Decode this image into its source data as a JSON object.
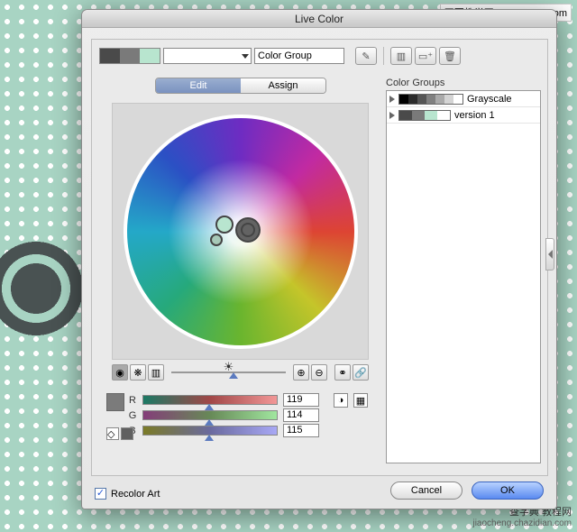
{
  "watermarks": {
    "top_right": "网页教学网\nwww.webjx.com",
    "bottom_right_title": "查字典 教程网",
    "bottom_right_sub": "jiaocheng.chazidian.com"
  },
  "dialog": {
    "title": "Live Color",
    "swatches": [
      "#4a4a4a",
      "#7a7a7a",
      "#b8e5cf"
    ],
    "color_group_field": "Color Group",
    "edit_icon": "✎",
    "storage_icons": [
      "save-icon",
      "new-folder-icon",
      "trash-icon"
    ],
    "tabs": {
      "edit": "Edit",
      "assign": "Assign",
      "selected": "edit"
    },
    "wheel_toolbar": {
      "left": [
        "smooth-wheel-icon",
        "segmented-wheel-icon",
        "bars-icon"
      ],
      "right": [
        "add-color-icon",
        "remove-color-icon",
        "unlink-icon",
        "link-icon"
      ]
    },
    "rgb": {
      "labels": {
        "r": "R",
        "g": "G",
        "b": "B"
      },
      "values": {
        "r": "119",
        "g": "114",
        "b": "115"
      }
    },
    "rgb_mode_icons": [
      "color-mode-icon",
      "swatch-grid-icon"
    ],
    "color_groups_label": "Color Groups",
    "color_groups": [
      {
        "name": "Grayscale",
        "colors": [
          "#000",
          "#2b2b2b",
          "#555",
          "#808080",
          "#aaa",
          "#d4d4d4",
          "#fff"
        ]
      },
      {
        "name": "version 1",
        "colors": [
          "#4a4a4a",
          "#7a7a7a",
          "#b8e5cf",
          "#ffffff"
        ]
      }
    ],
    "recolor_label": "Recolor Art",
    "recolor_checked": true,
    "buttons": {
      "cancel": "Cancel",
      "ok": "OK"
    }
  }
}
